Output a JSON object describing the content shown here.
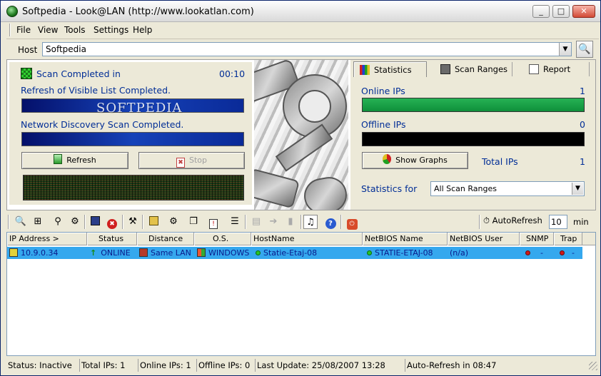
{
  "window": {
    "title": "Softpedia - Look@LAN (http://www.lookatlan.com)"
  },
  "menu": [
    "File",
    "View",
    "Tools",
    "Settings",
    "Help"
  ],
  "host": {
    "label": "Host",
    "value": "Softpedia"
  },
  "scan": {
    "title": "Scan Completed in",
    "time": "00:10",
    "refresh_text": "Refresh of Visible List Completed.",
    "network_text": "Network Discovery Scan Completed.",
    "refresh_button": "Refresh",
    "stop_button": "Stop",
    "watermark": "SOFTPEDIA"
  },
  "tabs": [
    "Statistics",
    "Scan Ranges",
    "Report"
  ],
  "stats": {
    "online_label": "Online IPs",
    "online_value": "1",
    "offline_label": "Offline IPs",
    "offline_value": "0",
    "show_graphs": "Show Graphs",
    "total_label": "Total IPs",
    "total_value": "1",
    "stats_for_label": "Statistics for",
    "stats_for_value": "All Scan Ranges"
  },
  "toolbar": {
    "icons": [
      "zoom-icon",
      "tree-icon",
      "binoculars-icon",
      "network-icon",
      "save-icon",
      "delete-icon",
      "tools-icon",
      "script-icon",
      "share-icon",
      "copy-icon",
      "info-icon",
      "export-icon",
      "import-icon",
      "forward-icon",
      "trash-icon",
      "sound-icon",
      "help-icon",
      "power-icon"
    ],
    "autorefresh_label": "AutoRefresh",
    "autorefresh_value": "10",
    "min_label": "min"
  },
  "table": {
    "columns": [
      "IP Address >",
      "Status",
      "Distance",
      "O.S.",
      "HostName",
      "NetBIOS Name",
      "NetBIOS User",
      "SNMP",
      "Trap"
    ],
    "rows": [
      {
        "ip": "10.9.0.34",
        "status": "ONLINE",
        "distance": "Same LAN",
        "os": "WINDOWS",
        "hostname": "Statie-Etaj-08",
        "netbios_name": "STATIE-ETAJ-08",
        "netbios_user": "(n/a)",
        "snmp": "-",
        "trap": "-"
      }
    ]
  },
  "statusbar": {
    "status": "Status: Inactive",
    "total": "Total IPs: 1",
    "online": "Online IPs: 1",
    "offline": "Offline IPs: 0",
    "last_update": "Last Update: 25/08/2007 13:28",
    "auto_refresh": "Auto-Refresh in 08:47"
  },
  "colors": {
    "accent_blue": "#002d96",
    "selection": "#35a8ee",
    "online_green": "#26b254"
  }
}
